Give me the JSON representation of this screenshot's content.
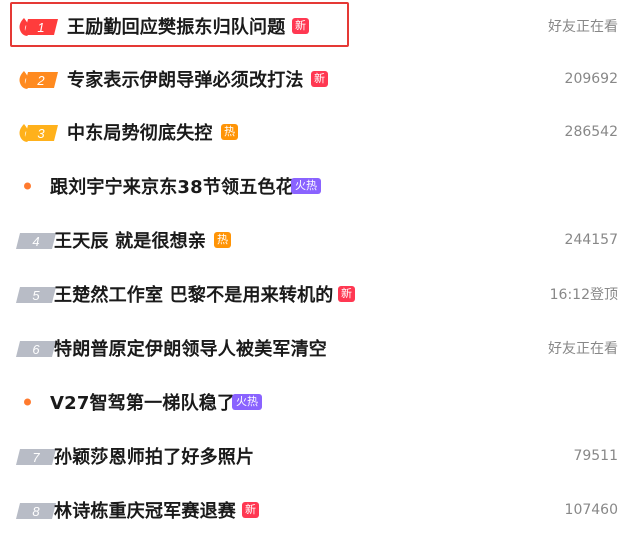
{
  "list": {
    "items": [
      {
        "rank": "1",
        "title": "王励勤回应樊振东归队问题",
        "badge": "新",
        "badge_type": "new",
        "meta": "好友正在看",
        "rank_style": "flame"
      },
      {
        "rank": "2",
        "title": "专家表示伊朗导弹必须改打法",
        "badge": "新",
        "badge_type": "new",
        "meta": "209692",
        "rank_style": "flame"
      },
      {
        "rank": "3",
        "title": "中东局势彻底失控",
        "badge": "热",
        "badge_type": "hot",
        "meta": "286542",
        "rank_style": "flame"
      },
      {
        "rank": "",
        "title": "跟刘宇宁来京东38节领五色花",
        "badge": "火热",
        "badge_type": "fire",
        "meta": "",
        "rank_style": "dot"
      },
      {
        "rank": "4",
        "title": "王天辰 就是很想亲",
        "badge": "热",
        "badge_type": "hot",
        "meta": "244157",
        "rank_style": "gray"
      },
      {
        "rank": "5",
        "title": "王楚然工作室 巴黎不是用来转机的",
        "badge": "新",
        "badge_type": "new",
        "meta": "16:12登顶",
        "rank_style": "gray"
      },
      {
        "rank": "6",
        "title": "特朗普原定伊朗领导人被美军清空",
        "badge": "",
        "badge_type": "",
        "meta": "好友正在看",
        "rank_style": "gray"
      },
      {
        "rank": "",
        "title": "V27智驾第一梯队稳了",
        "badge": "火热",
        "badge_type": "fire",
        "meta": "",
        "rank_style": "dot"
      },
      {
        "rank": "7",
        "title": "孙颖莎恩师拍了好多照片",
        "badge": "",
        "badge_type": "",
        "meta": "79511",
        "rank_style": "gray"
      },
      {
        "rank": "8",
        "title": "林诗栋重庆冠军赛退赛",
        "badge": "新",
        "badge_type": "new",
        "meta": "107460",
        "rank_style": "gray"
      }
    ]
  },
  "colors": {
    "highlight_border": "#e53935",
    "rank1": "#ff3c3c",
    "rank2": "#ff8a1f",
    "rank3": "#ffb11b",
    "rank_gray": "#b8bcc6",
    "badge_new": "#ff3852",
    "badge_hot": "#ff9406",
    "badge_fire": "#8a63ff",
    "dot": "#ff7a2e"
  }
}
